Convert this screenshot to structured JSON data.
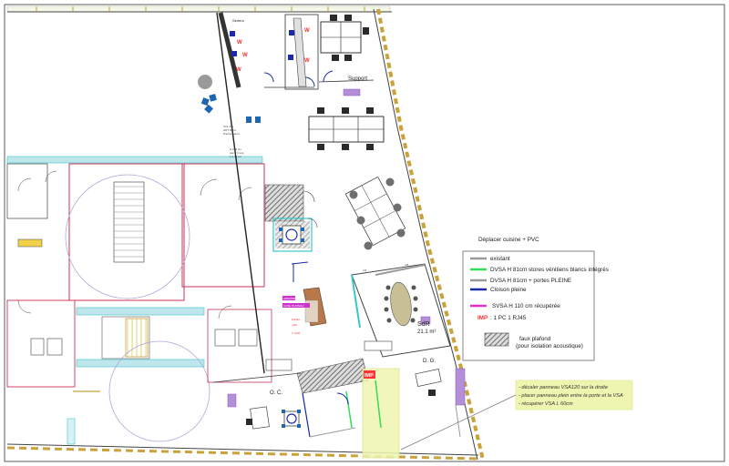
{
  "rooms": {
    "support": "Support",
    "sdr_name": "SdR",
    "sdr_area": "21.1 m²",
    "dg": "D. G.",
    "oc": "O. C.",
    "imp": "IMP",
    "top_small": "Sérieur"
  },
  "legend": {
    "title": "Déplacer cuisine + PVC",
    "items": [
      {
        "text": "existant",
        "color": "#9a9a9a",
        "kind": "line"
      },
      {
        "text": "DVSA H 81cm  stores vénitiens blancs intégrés",
        "color": "#33dd55",
        "kind": "line"
      },
      {
        "text": "DVSA H 81cm + portes PLEINE",
        "color": "#9a9a9a",
        "kind": "line"
      },
      {
        "text": "Cloison pleine",
        "color": "#1a2aa8",
        "kind": "line"
      },
      {
        "text": "SVSA  H 110 cm récupérée",
        "color": "#dd33cc",
        "kind": "line"
      },
      {
        "text": ": 1 PC 1 RJ45",
        "color": "#ff3333",
        "kind": "imp",
        "prefix": "IMP"
      },
      {
        "text": "faux plafond",
        "color": "#888888",
        "kind": "hatch",
        "text2": "(pour isolation acoustique)"
      }
    ]
  },
  "note": {
    "lines": [
      "- décaler panneau  VSA120 sur la droite",
      "- placer panneau plein entre la porte et la VSA",
      "- récupérer VSA L 60cm"
    ]
  },
  "colors": {
    "wall": "#222222",
    "cyan": "#37c6cf",
    "magenta": "#cc33cc",
    "purple": "#9955cc",
    "hatch": "#666666",
    "yellow": "#eef5b0",
    "desk": "#ffffff",
    "chair": "#2a2a2a"
  }
}
